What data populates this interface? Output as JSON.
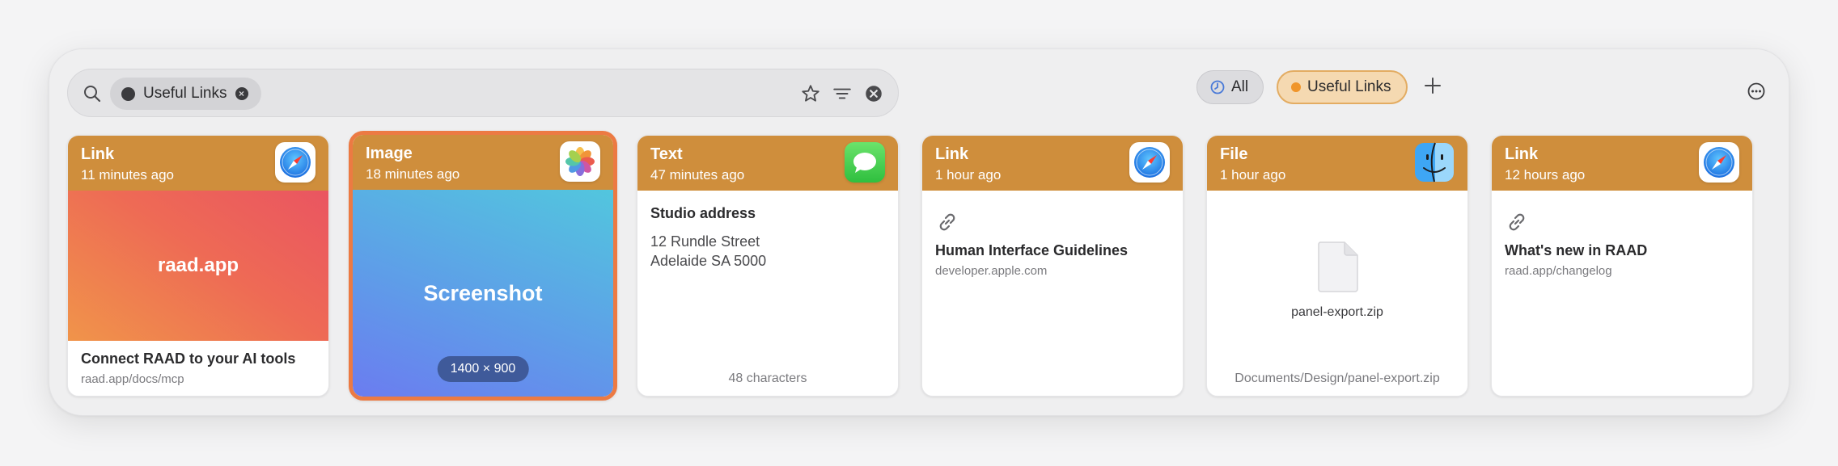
{
  "search": {
    "chip_label": "Useful Links",
    "placeholder": ""
  },
  "filters": [
    {
      "label": "All",
      "icon": "clock-icon",
      "color": "#4a7ad8"
    },
    {
      "label": "Useful Links",
      "icon": "orange-dot",
      "color": "#f0952a"
    }
  ],
  "colors": {
    "card_header": "#cf8e3c",
    "selection": "#ec7a43"
  },
  "cards": [
    {
      "type": "Link",
      "time": "11 minutes ago",
      "app_icon": "safari-icon",
      "preview_text": "raad.app",
      "title": "Connect RAAD to your AI tools",
      "subtitle": "raad.app/docs/mcp"
    },
    {
      "type": "Image",
      "time": "18 minutes ago",
      "app_icon": "photos-icon",
      "preview_text": "Screenshot",
      "dimensions": "1400 × 900"
    },
    {
      "type": "Text",
      "time": "47 minutes ago",
      "app_icon": "messages-icon",
      "title": "Studio address",
      "line1": "12 Rundle Street",
      "line2": "Adelaide SA 5000",
      "footer": "48 characters"
    },
    {
      "type": "Link",
      "time": "1 hour ago",
      "app_icon": "safari-icon",
      "title": "Human Interface Guidelines",
      "subtitle": "developer.apple.com"
    },
    {
      "type": "File",
      "time": "1 hour ago",
      "app_icon": "finder-icon",
      "file_name": "panel-export.zip",
      "path": "Documents/Design/panel-export.zip"
    },
    {
      "type": "Link",
      "time": "12 hours ago",
      "app_icon": "safari-icon",
      "title": "What's new in RAAD",
      "subtitle": "raad.app/changelog"
    }
  ]
}
